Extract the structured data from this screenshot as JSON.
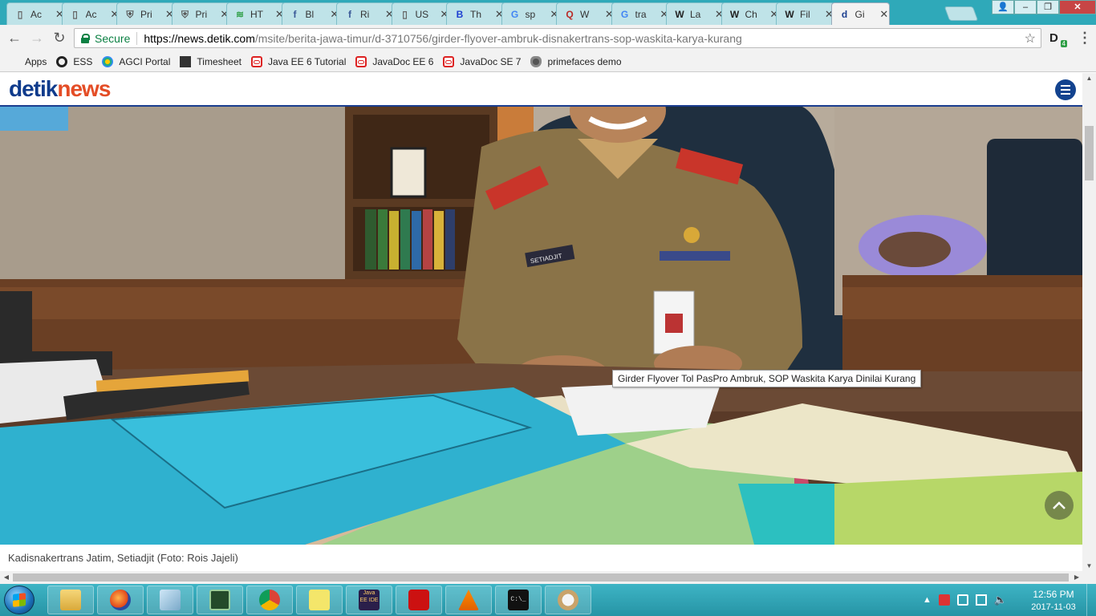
{
  "tabs": [
    {
      "label": "Ac",
      "icon": "page-icon",
      "color": "#666666"
    },
    {
      "label": "Ac",
      "icon": "page-icon",
      "color": "#666666"
    },
    {
      "label": "Pri",
      "icon": "shield-icon",
      "color": "#555555"
    },
    {
      "label": "Pri",
      "icon": "shield-icon",
      "color": "#555555"
    },
    {
      "label": "HT",
      "icon": "chart-icon",
      "color": "#2e9e45"
    },
    {
      "label": "Bl",
      "icon": "facebook-icon",
      "color": "#3b5998"
    },
    {
      "label": "Ri",
      "icon": "facebook-icon",
      "color": "#3b5998"
    },
    {
      "label": "US",
      "icon": "page-icon",
      "color": "#666666"
    },
    {
      "label": "Th",
      "icon": "b-icon",
      "color": "#1e3fd1"
    },
    {
      "label": "sp",
      "icon": "google-icon",
      "color": "#4285f4"
    },
    {
      "label": "W",
      "icon": "quora-icon",
      "color": "#b92b27"
    },
    {
      "label": "tra",
      "icon": "google-icon",
      "color": "#4285f4"
    },
    {
      "label": "La",
      "icon": "wikipedia-icon",
      "color": "#222222"
    },
    {
      "label": "Ch",
      "icon": "wikipedia-icon",
      "color": "#222222"
    },
    {
      "label": "Fil",
      "icon": "wikipedia-icon",
      "color": "#222222"
    },
    {
      "label": "Gi",
      "icon": "detik-icon",
      "color": "#1a3d8f",
      "active": true
    }
  ],
  "window": {
    "minimize": "–",
    "maximize": "❐",
    "close": "✕",
    "profile": "👤"
  },
  "toolbar": {
    "secure_label": "Secure",
    "url_host": "https://news.detik.com",
    "url_path": "/msite/berita-jawa-timur/d-3710756/girder-flyover-ambruk-disnakertrans-sop-waskita-karya-kurang",
    "extension_badge": "4",
    "extension_letter": "D"
  },
  "bookmarks": [
    {
      "label": "Apps"
    },
    {
      "label": "ESS"
    },
    {
      "label": "AGCI Portal"
    },
    {
      "label": "Timesheet"
    },
    {
      "label": "Java EE 6 Tutorial"
    },
    {
      "label": "JavaDoc EE 6"
    },
    {
      "label": "JavaDoc SE 7"
    },
    {
      "label": "primefaces demo"
    }
  ],
  "site": {
    "logo_part1": "detik",
    "logo_part2": "news"
  },
  "article": {
    "photo_caption": "Kadisnakertrans Jatim, Setiadjit (Foto: Rois Jajeli)",
    "tooltip": "Girder Flyover Tol PasPro Ambruk, SOP Waskita Karya Dinilai Kurang",
    "name_tag": "SETIADJIT"
  },
  "taskbar": {
    "apps": [
      "Windows Explorer",
      "Firefox",
      "Notepad",
      "Task Manager",
      "Chrome",
      "Sticky Notes",
      "Java EE IDE",
      "Adobe Reader",
      "VLC",
      "Command Prompt",
      "Paint"
    ],
    "java_ide_label": "Java EE IDE",
    "cmd_label": "C:\\_",
    "time": "12:56 PM",
    "date": "2017-11-03"
  },
  "colors": {
    "tabstrip": "#2fa9b9",
    "brand_blue": "#0f3b8c",
    "brand_orange": "#e44d26",
    "secure_green": "#0b8043"
  }
}
